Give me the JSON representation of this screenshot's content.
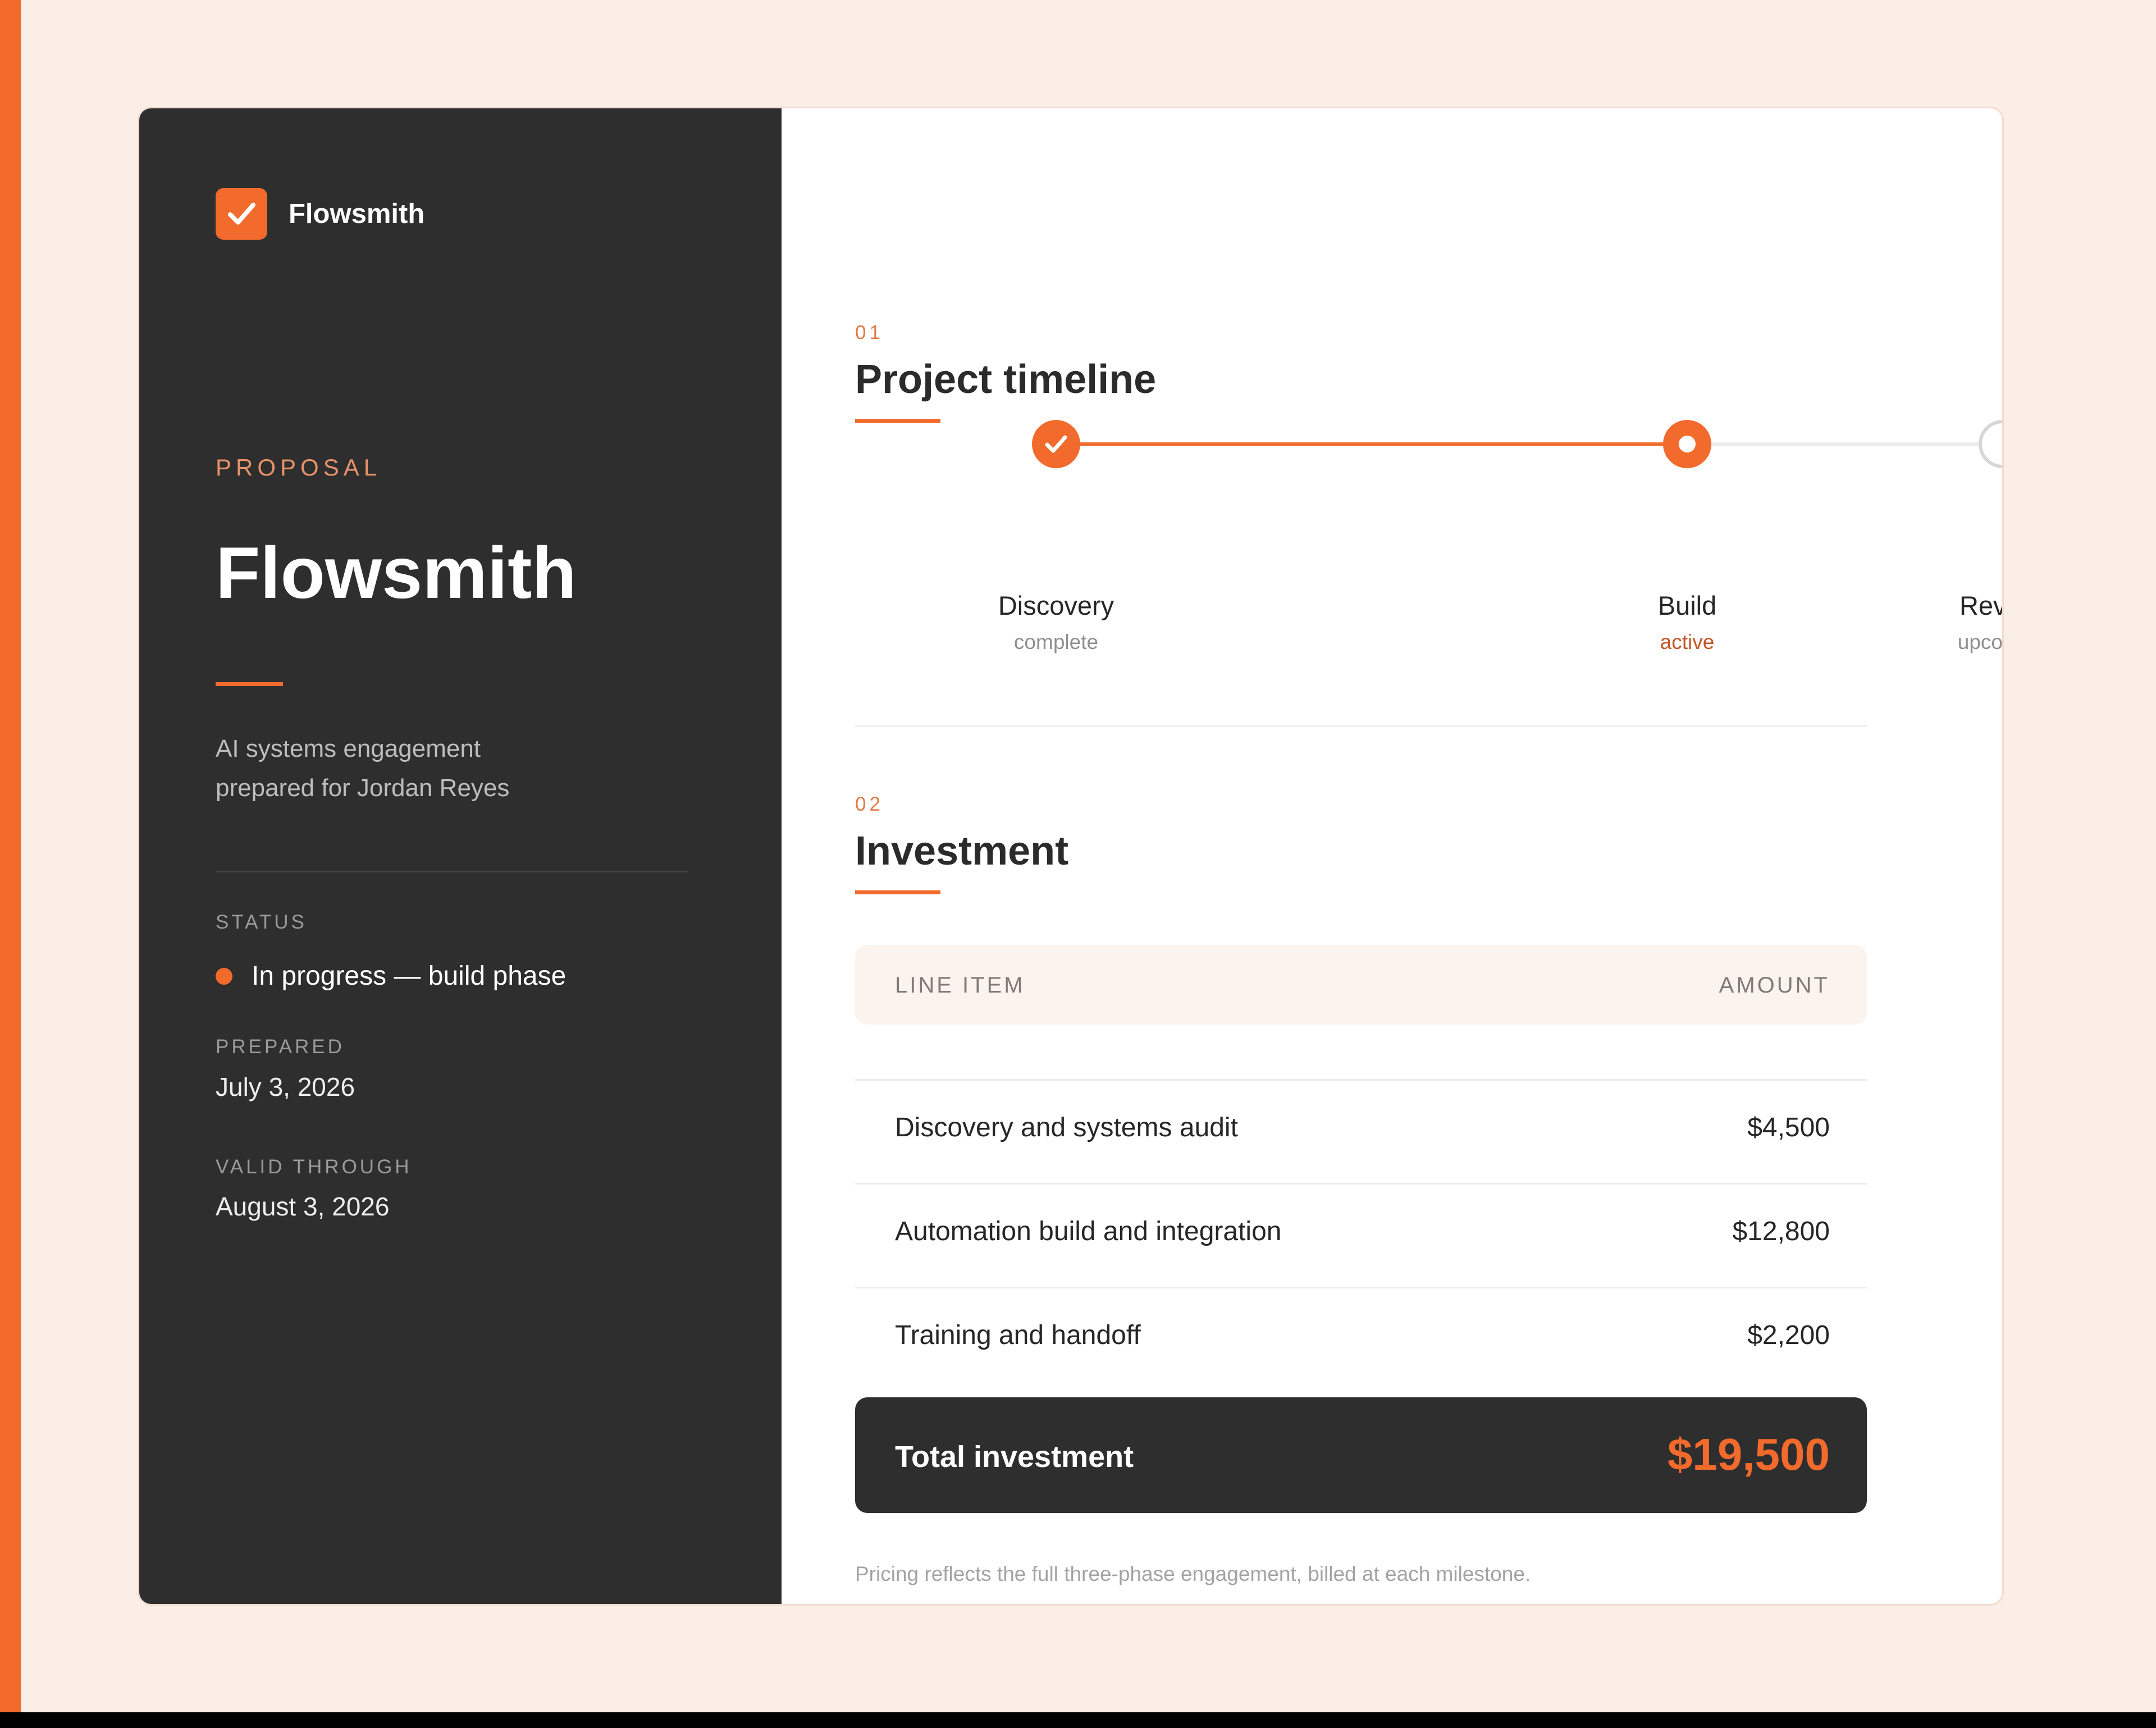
{
  "colors": {
    "accent": "#f26a2c",
    "sidebar_bg": "#2e2e2e",
    "page_bg": "#faeee6",
    "table_header_bg": "#fbf3ee"
  },
  "brand": {
    "name": "Flowsmith",
    "logo_icon": "check-square-icon"
  },
  "sidebar": {
    "eyebrow": "PROPOSAL",
    "title": "Flowsmith",
    "subtitle_line1": "AI systems engagement",
    "subtitle_line2": "prepared for Jordan Reyes",
    "status": {
      "label": "STATUS",
      "value": "In progress — build phase"
    },
    "prepared": {
      "label": "PREPARED",
      "value": "July 3, 2026"
    },
    "valid_through": {
      "label": "VALID THROUGH",
      "value": "August 3, 2026"
    }
  },
  "timeline": {
    "number": "01",
    "title": "Project timeline",
    "steps": [
      {
        "name": "Discovery",
        "state": "complete"
      },
      {
        "name": "Build",
        "state": "active"
      },
      {
        "name": "Review",
        "state": "upcoming"
      }
    ]
  },
  "investment": {
    "number": "02",
    "title": "Investment",
    "columns": {
      "item": "LINE ITEM",
      "amount": "AMOUNT"
    },
    "rows": [
      {
        "item": "Discovery and systems audit",
        "amount": "$4,500"
      },
      {
        "item": "Automation build and integration",
        "amount": "$12,800"
      },
      {
        "item": "Training and handoff",
        "amount": "$2,200"
      }
    ],
    "total_label": "Total investment",
    "total_value": "$19,500",
    "footnote": "Pricing reflects the full three-phase engagement, billed at each milestone."
  }
}
